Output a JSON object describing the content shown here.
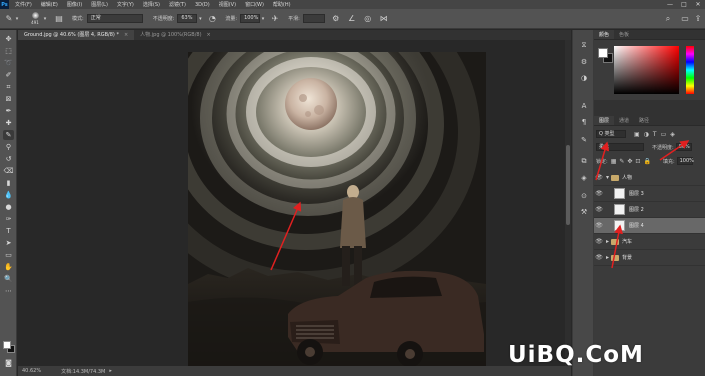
{
  "app": {
    "logo": "Ps"
  },
  "menu": [
    "文件(F)",
    "编辑(E)",
    "图像(I)",
    "图层(L)",
    "文字(Y)",
    "选择(S)",
    "滤镜(T)",
    "3D(D)",
    "视图(V)",
    "窗口(W)",
    "帮助(H)"
  ],
  "window_controls": [
    "—",
    "□",
    "✕"
  ],
  "options": {
    "brush_size": "491",
    "mode_label": "模式:",
    "mode_value": "正常",
    "opacity_label": "不透明度:",
    "opacity_value": "63%",
    "flow_label": "流量:",
    "flow_value": "100%",
    "smoothing_label": "平滑:"
  },
  "tabs": [
    {
      "label": "Ground.jpg @ 40.6% (图层 4, RGB/8) *",
      "close": "×"
    },
    {
      "label": "人物.jpg @ 100%(RGB/8)",
      "close": "×"
    }
  ],
  "status": {
    "zoom": "40.62%",
    "doc": "文档:14.3M/74.3M"
  },
  "color_panel": {
    "tabs": [
      "颜色",
      "色板"
    ],
    "fg": "#ffffff",
    "bg": "#111111"
  },
  "layers_panel": {
    "tabs": [
      "图层",
      "通道",
      "路径"
    ],
    "filter_label": "Q 类型",
    "blend_mode": "柔光",
    "opacity_label": "不透明度:",
    "opacity_value": "80%",
    "lock_label": "锁定:",
    "fill_label": "填充:",
    "fill_value": "100%",
    "layers": [
      {
        "name": "人物",
        "type": "group",
        "visible": true,
        "selected": false
      },
      {
        "name": "图层 3",
        "type": "layer",
        "visible": true,
        "selected": false
      },
      {
        "name": "图层 2",
        "type": "layer",
        "visible": true,
        "selected": false
      },
      {
        "name": "图层 4",
        "type": "layer",
        "visible": true,
        "selected": true
      },
      {
        "name": "汽车",
        "type": "group",
        "visible": true,
        "selected": false
      },
      {
        "name": "背景",
        "type": "group",
        "visible": true,
        "selected": false
      }
    ]
  },
  "watermark": "UiBQ.CoM",
  "colors": {
    "annotation_arrow": "#e02020",
    "accent": "#31a8ff"
  }
}
